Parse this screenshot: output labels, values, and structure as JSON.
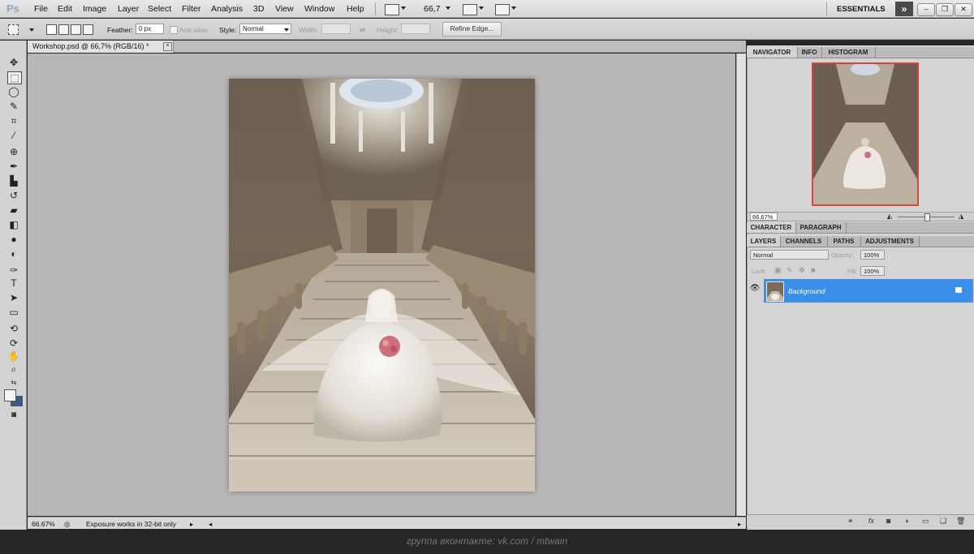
{
  "app": {
    "logo": "Ps",
    "menu": [
      "File",
      "Edit",
      "Image",
      "Layer",
      "Select",
      "Filter",
      "Analysis",
      "3D",
      "View",
      "Window",
      "Help"
    ],
    "zoom_select": "66,7",
    "workspace": "ESSENTIALS",
    "expand_glyph": "»"
  },
  "options": {
    "feather_label": "Feather:",
    "feather_value": "0 px",
    "antialias_label": "Anti-alias",
    "style_label": "Style:",
    "style_value": "Normal",
    "width_label": "Width:",
    "height_label": "Height:",
    "refine_edge": "Refine Edge..."
  },
  "document": {
    "tab_title": "Workshop.psd @ 66,7% (RGB/16) *",
    "close_glyph": "×",
    "status_zoom": "66.67%",
    "status_message": "Exposure works in 32-bit only"
  },
  "navigator": {
    "tabs": [
      "NAVIGATOR",
      "INFO",
      "HISTOGRAM"
    ],
    "zoom": "66.67%"
  },
  "character": {
    "tabs": [
      "CHARACTER",
      "PARAGRAPH"
    ]
  },
  "layers": {
    "tabs": [
      "LAYERS",
      "CHANNELS",
      "PATHS",
      "ADJUSTMENTS"
    ],
    "blend_mode": "Normal",
    "opacity_label": "Opacity:",
    "opacity_value": "100%",
    "lock_label": "Lock:",
    "fill_label": "Fill:",
    "fill_value": "100%",
    "items": [
      {
        "name": "Background"
      }
    ]
  },
  "icons": {
    "tools": [
      "move-icon",
      "marquee-icon",
      "lasso-icon",
      "quick-select-icon",
      "crop-icon",
      "eyedropper-icon",
      "healing-icon",
      "brush-icon",
      "stamp-icon",
      "history-brush-icon",
      "eraser-icon",
      "gradient-icon",
      "blur-icon",
      "dodge-icon",
      "pen-icon",
      "type-icon",
      "path-select-icon",
      "shape-icon",
      "3d-rotate-icon",
      "3d-orbit-icon",
      "hand-icon",
      "zoom-icon"
    ]
  },
  "footer": {
    "caption": "группа вконтакте: vk.com / mtwain"
  }
}
